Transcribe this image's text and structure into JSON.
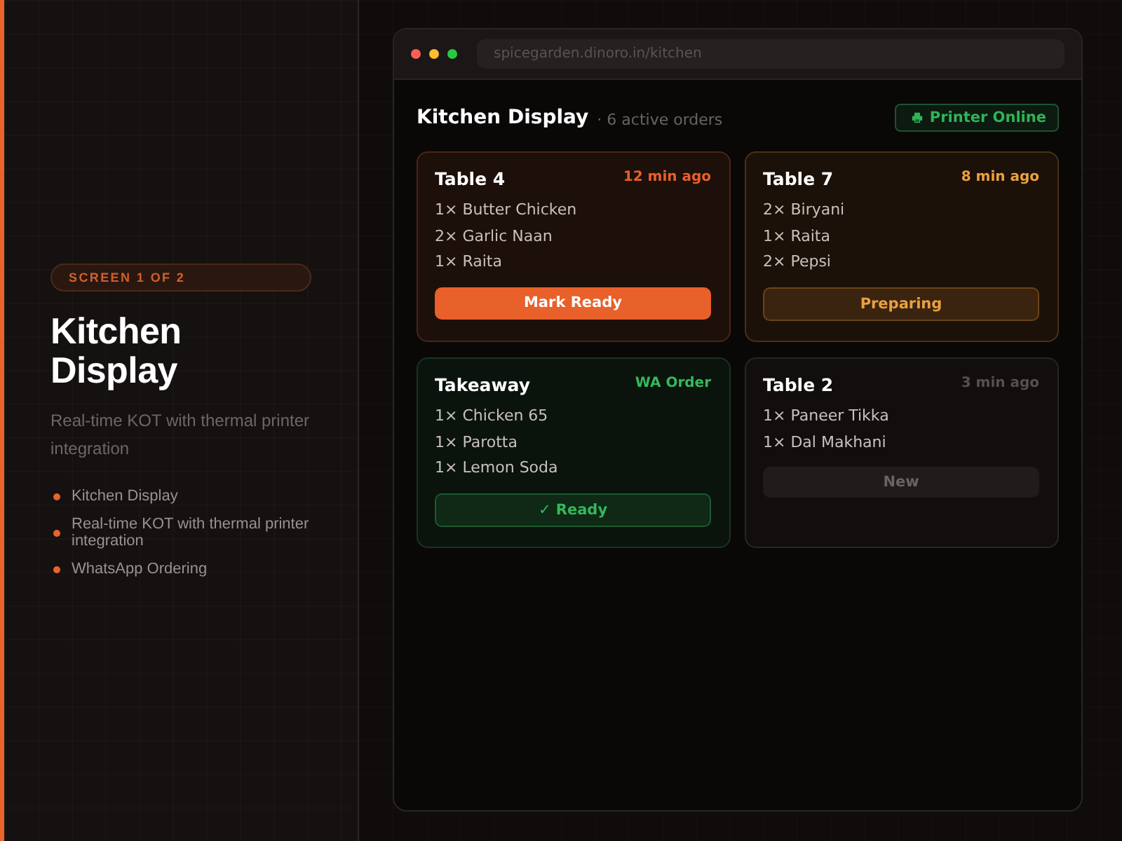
{
  "sidebar": {
    "badge": "SCREEN 1 OF 2",
    "title": "Kitchen Display",
    "description": "Real-time KOT with thermal printer integration",
    "features": [
      "Kitchen Display",
      "Real-time KOT with thermal printer integration",
      "WhatsApp Ordering"
    ]
  },
  "browser": {
    "url": "spicegarden.dinoro.in/kitchen"
  },
  "header": {
    "title": "Kitchen Display",
    "subtitle": "· 6 active orders",
    "printer_status": "Printer Online"
  },
  "orders": [
    {
      "name": "Table 4",
      "meta": "12 min ago",
      "kind": "urgent",
      "items": [
        "1× Butter Chicken",
        "2× Garlic Naan",
        "1× Raita"
      ],
      "action": "Mark Ready"
    },
    {
      "name": "Table 7",
      "meta": "8 min ago",
      "kind": "preparing",
      "items": [
        "2× Biryani",
        "1× Raita",
        "2× Pepsi"
      ],
      "action": "Preparing"
    },
    {
      "name": "Takeaway",
      "meta": "WA Order",
      "kind": "ready",
      "items": [
        "1× Chicken 65",
        "1× Parotta",
        "1× Lemon Soda"
      ],
      "action": "✓ Ready"
    },
    {
      "name": "Table 2",
      "meta": "3 min ago",
      "kind": "new",
      "items": [
        "1× Paneer Tikka",
        "1× Dal Makhani"
      ],
      "action": "New"
    }
  ]
}
